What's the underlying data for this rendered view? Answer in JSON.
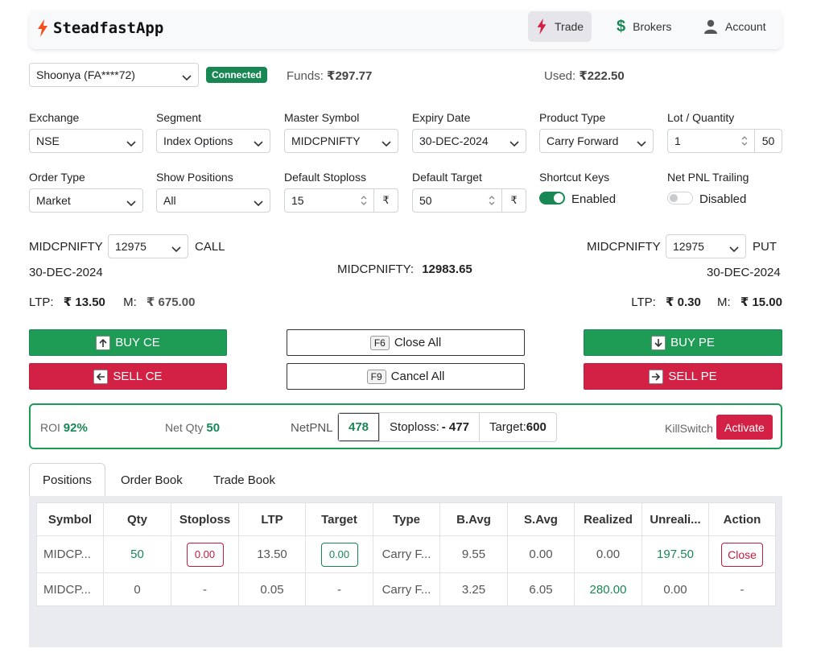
{
  "nav": {
    "brand": "SteadfastApp",
    "items": [
      {
        "label": "Trade",
        "icon": "bolt-icon"
      },
      {
        "label": "Brokers",
        "icon": "dollar-icon"
      },
      {
        "label": "Account",
        "icon": "user-icon"
      }
    ]
  },
  "account": {
    "broker": "Shoonya (FA****72)",
    "status": "Connected",
    "funds_label": "Funds:",
    "funds_value": "₹297.77",
    "used_label": "Used:",
    "used_value": "₹222.50"
  },
  "form": {
    "exchange_label": "Exchange",
    "exchange": "NSE",
    "segment_label": "Segment",
    "segment": "Index Options",
    "master_symbol_label": "Master Symbol",
    "master_symbol": "MIDCPNIFTY",
    "expiry_label": "Expiry Date",
    "expiry": "30-DEC-2024",
    "product_label": "Product Type",
    "product": "Carry Forward",
    "lot_label": "Lot / Quantity",
    "lot": "1",
    "quantity": "50",
    "order_type_label": "Order Type",
    "order_type": "Market",
    "show_positions_label": "Show Positions",
    "show_positions": "All",
    "stoploss_label": "Default Stoploss",
    "stoploss": "15",
    "stoploss_unit": "₹",
    "target_label": "Default Target",
    "target": "50",
    "target_unit": "₹",
    "shortcut_label": "Shortcut Keys",
    "shortcut_state": "Enabled",
    "trailing_label": "Net PNL Trailing",
    "trailing_state": "Disabled"
  },
  "call": {
    "symbol": "MIDCPNIFTY",
    "strike": "12975",
    "side": "CALL",
    "expiry": "30-DEC-2024",
    "ltp_label": "LTP:",
    "ltp": "₹ 13.50",
    "m_label": "M:",
    "m": "₹ 675.00"
  },
  "put": {
    "symbol": "MIDCPNIFTY",
    "strike": "12975",
    "side": "PUT",
    "expiry": "30-DEC-2024",
    "ltp_label": "LTP:",
    "ltp": "₹ 0.30",
    "m_label": "M:",
    "m": "₹ 15.00"
  },
  "index": {
    "label": "MIDCPNIFTY:",
    "value": "12983.65"
  },
  "buttons": {
    "buy_ce": "BUY CE",
    "sell_ce": "SELL CE",
    "buy_pe": "BUY PE",
    "sell_pe": "SELL PE",
    "close_all_key": "F6",
    "close_all": "Close All",
    "cancel_all_key": "F9",
    "cancel_all": "Cancel All"
  },
  "summary": {
    "roi_label": "ROI",
    "roi": "92%",
    "netqty_label": "Net Qty",
    "netqty": "50",
    "netpnl_label": "NetPNL",
    "netpnl": "478",
    "stoploss_text": "Stoploss:",
    "stoploss_value": "- 477",
    "target_text": "Target:",
    "target_value": "600",
    "killswitch_label": "KillSwitch",
    "activate": "Activate"
  },
  "tabs": [
    "Positions",
    "Order Book",
    "Trade Book"
  ],
  "table": {
    "headers": [
      "Symbol",
      "Qty",
      "Stoploss",
      "LTP",
      "Target",
      "Type",
      "B.Avg",
      "S.Avg",
      "Realized",
      "Unreali...",
      "Action"
    ],
    "rows": [
      {
        "symbol": "MIDCP...",
        "qty": "50",
        "stoploss": "0.00",
        "ltp": "13.50",
        "target": "0.00",
        "type": "Carry F...",
        "bavg": "9.55",
        "savg": "0.00",
        "realized": "0.00",
        "unrealized": "197.50",
        "action": "Close"
      },
      {
        "symbol": "MIDCP...",
        "qty": "0",
        "stoploss": "-",
        "ltp": "0.05",
        "target": "-",
        "type": "Carry F...",
        "bavg": "3.25",
        "savg": "6.05",
        "realized": "280.00",
        "unrealized": "0.00",
        "action": "-"
      }
    ]
  },
  "colors": {
    "green": "#198754",
    "red": "#d22144",
    "accent_bolt": "#f4511e"
  }
}
